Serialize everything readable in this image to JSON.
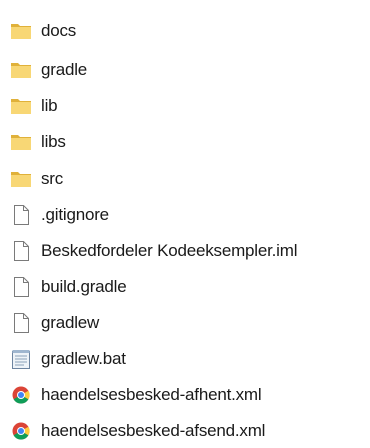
{
  "files": [
    {
      "name": "docs",
      "icon": "folder-icon"
    },
    {
      "name": "gradle",
      "icon": "folder-icon"
    },
    {
      "name": "lib",
      "icon": "folder-icon"
    },
    {
      "name": "libs",
      "icon": "folder-icon"
    },
    {
      "name": "src",
      "icon": "folder-icon"
    },
    {
      "name": ".gitignore",
      "icon": "file-icon"
    },
    {
      "name": "Beskedfordeler Kodeeksempler.iml",
      "icon": "file-icon"
    },
    {
      "name": "build.gradle",
      "icon": "file-icon"
    },
    {
      "name": "gradlew",
      "icon": "file-icon"
    },
    {
      "name": "gradlew.bat",
      "icon": "batch-file-icon"
    },
    {
      "name": "haendelsesbesked-afhent.xml",
      "icon": "chrome-icon"
    },
    {
      "name": "haendelsesbesked-afsend.xml",
      "icon": "chrome-icon"
    }
  ],
  "colors": {
    "folder": "#f8d775",
    "folder_dark": "#e0b13a",
    "text": "#1a1a1a"
  }
}
